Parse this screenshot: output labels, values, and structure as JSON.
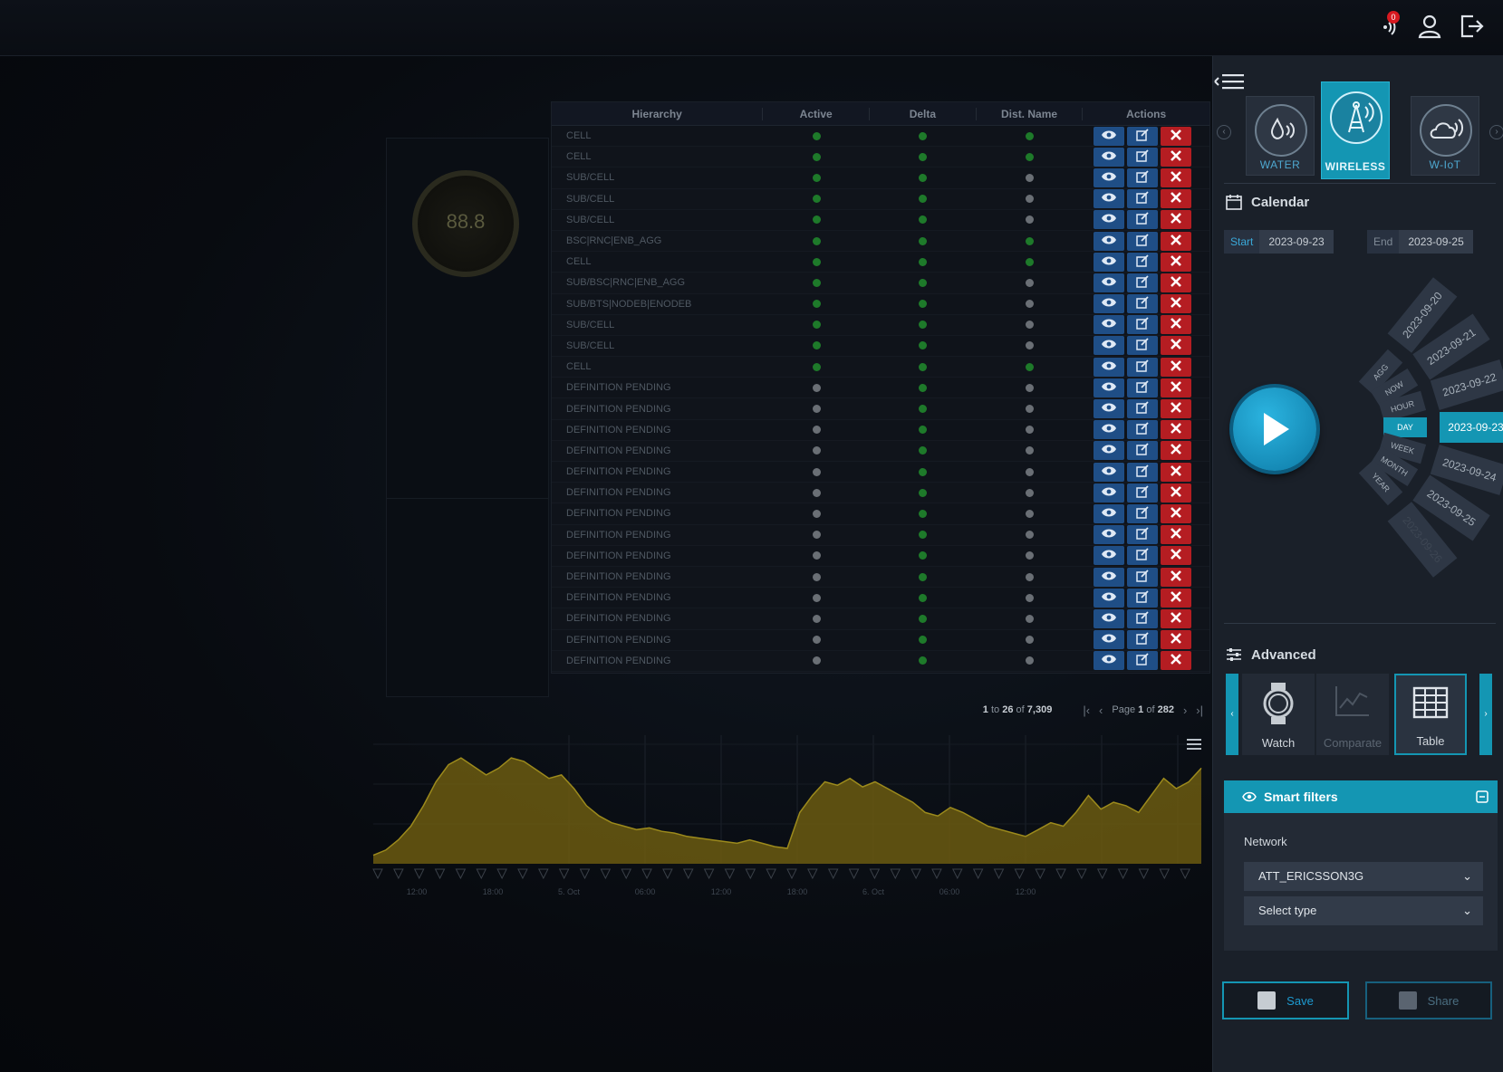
{
  "topbar": {
    "notification_count": "0"
  },
  "table": {
    "headers": {
      "hierarchy": "Hierarchy",
      "active": "Active",
      "delta": "Delta",
      "dist_name": "Dist. Name",
      "actions": "Actions"
    },
    "rows": [
      {
        "hierarchy": "CELL",
        "active": "green",
        "delta": "green",
        "dist": "green"
      },
      {
        "hierarchy": "CELL",
        "active": "green",
        "delta": "green",
        "dist": "green"
      },
      {
        "hierarchy": "SUB/CELL",
        "active": "green",
        "delta": "green",
        "dist": "grey"
      },
      {
        "hierarchy": "SUB/CELL",
        "active": "green",
        "delta": "green",
        "dist": "grey"
      },
      {
        "hierarchy": "SUB/CELL",
        "active": "green",
        "delta": "green",
        "dist": "grey"
      },
      {
        "hierarchy": "BSC|RNC|ENB_AGG",
        "active": "green",
        "delta": "green",
        "dist": "green"
      },
      {
        "hierarchy": "CELL",
        "active": "green",
        "delta": "green",
        "dist": "green"
      },
      {
        "hierarchy": "SUB/BSC|RNC|ENB_AGG",
        "active": "green",
        "delta": "green",
        "dist": "grey"
      },
      {
        "hierarchy": "SUB/BTS|NODEB|ENODEB",
        "active": "green",
        "delta": "green",
        "dist": "grey"
      },
      {
        "hierarchy": "SUB/CELL",
        "active": "green",
        "delta": "green",
        "dist": "grey"
      },
      {
        "hierarchy": "SUB/CELL",
        "active": "green",
        "delta": "green",
        "dist": "grey"
      },
      {
        "hierarchy": "CELL",
        "active": "green",
        "delta": "green",
        "dist": "green"
      },
      {
        "hierarchy": "DEFINITION PENDING",
        "active": "grey",
        "delta": "green",
        "dist": "grey"
      },
      {
        "hierarchy": "DEFINITION PENDING",
        "active": "grey",
        "delta": "green",
        "dist": "grey"
      },
      {
        "hierarchy": "DEFINITION PENDING",
        "active": "grey",
        "delta": "green",
        "dist": "grey"
      },
      {
        "hierarchy": "DEFINITION PENDING",
        "active": "grey",
        "delta": "green",
        "dist": "grey"
      },
      {
        "hierarchy": "DEFINITION PENDING",
        "active": "grey",
        "delta": "green",
        "dist": "grey"
      },
      {
        "hierarchy": "DEFINITION PENDING",
        "active": "grey",
        "delta": "green",
        "dist": "grey"
      },
      {
        "hierarchy": "DEFINITION PENDING",
        "active": "grey",
        "delta": "green",
        "dist": "grey"
      },
      {
        "hierarchy": "DEFINITION PENDING",
        "active": "grey",
        "delta": "green",
        "dist": "grey"
      },
      {
        "hierarchy": "DEFINITION PENDING",
        "active": "grey",
        "delta": "green",
        "dist": "grey"
      },
      {
        "hierarchy": "DEFINITION PENDING",
        "active": "grey",
        "delta": "green",
        "dist": "grey"
      },
      {
        "hierarchy": "DEFINITION PENDING",
        "active": "grey",
        "delta": "green",
        "dist": "grey"
      },
      {
        "hierarchy": "DEFINITION PENDING",
        "active": "grey",
        "delta": "green",
        "dist": "grey"
      },
      {
        "hierarchy": "DEFINITION PENDING",
        "active": "grey",
        "delta": "green",
        "dist": "grey"
      },
      {
        "hierarchy": "DEFINITION PENDING",
        "active": "grey",
        "delta": "green",
        "dist": "grey"
      }
    ],
    "pager": {
      "range_start": "1",
      "range_end": "26",
      "total": "7,309",
      "page": "1",
      "page_total": "282",
      "to_text": "to",
      "of_text": "of",
      "page_label": "Page"
    }
  },
  "gauge": {
    "value": "88.8"
  },
  "chart_data": {
    "type": "area",
    "x_ticks": [
      "12:00",
      "18:00",
      "5. Oct",
      "06:00",
      "12:00",
      "18:00",
      "6. Oct",
      "06:00",
      "12:00"
    ],
    "series": [
      {
        "values": [
          5,
          8,
          14,
          22,
          34,
          48,
          58,
          62,
          57,
          52,
          56,
          62,
          60,
          55,
          50,
          52,
          44,
          34,
          28,
          24,
          22,
          20,
          21,
          19,
          18,
          16,
          15,
          14,
          13,
          12,
          14,
          12,
          10,
          9,
          30,
          40,
          48,
          46,
          50,
          45,
          48,
          44,
          40,
          36,
          30,
          28,
          33,
          30,
          26,
          22,
          20,
          18,
          16,
          20,
          24,
          22,
          30,
          40,
          32,
          36,
          34,
          30,
          40,
          50,
          44,
          48,
          56
        ]
      }
    ],
    "colors": {
      "area": "#6b5a10",
      "stroke": "#9c8a1c"
    },
    "grid": true
  },
  "rpanel": {
    "modules": [
      {
        "label": "WATER",
        "icon": "water-wifi-icon"
      },
      {
        "label": "WIRELESS",
        "icon": "antenna-icon"
      },
      {
        "label": "W-IoT",
        "icon": "cloud-iot-icon"
      }
    ],
    "calendar": {
      "title": "Calendar",
      "start_label": "Start",
      "start_value": "2023-09-23",
      "end_label": "End",
      "end_value": "2023-09-25"
    },
    "granularity": [
      "AGG",
      "NOW",
      "HOUR",
      "DAY",
      "WEEK",
      "MONTH",
      "YEAR"
    ],
    "granularity_selected": "DAY",
    "days": [
      "2023-09-20",
      "2023-09-21",
      "2023-09-22",
      "2023-09-23",
      "2023-09-24",
      "2023-09-25",
      "2023-09-26"
    ],
    "day_selected": "2023-09-23",
    "advanced": {
      "title": "Advanced",
      "views": [
        {
          "label": "Watch"
        },
        {
          "label": "Comparate"
        },
        {
          "label": "Table"
        }
      ]
    },
    "smart_filters": {
      "title": "Smart filters",
      "network_label": "Network",
      "network_value": "ATT_ERICSSON3G",
      "type_placeholder": "Select type"
    },
    "save_label": "Save",
    "share_label": "Share"
  },
  "colors": {
    "accent": "#1496b3",
    "delete": "#b51d22",
    "action_blue": "#1f4e86"
  }
}
